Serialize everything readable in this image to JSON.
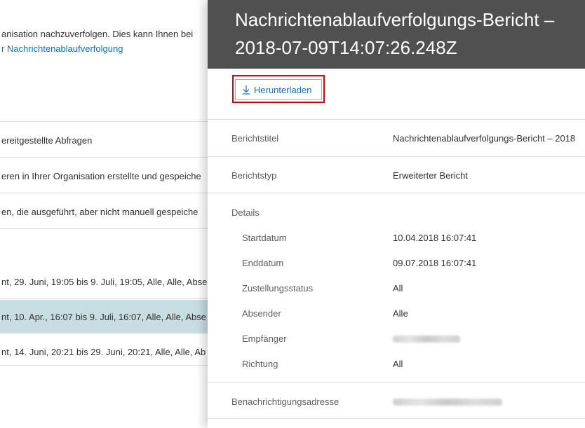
{
  "background_page": {
    "line1": "anisation nachzuverfolgen. Dies kann Ihnen bei",
    "line2_link": "r Nachrichtenablaufverfolgung",
    "rows": [
      "ereitgestellte Abfragen",
      "eren in Ihrer Organisation erstellte und gespeiche",
      "en, die ausgeführt, aber nicht manuell gespeiche"
    ],
    "results": [
      {
        "text": "nt, 29. Juni, 19:05 bis 9. Juli, 19:05, Alle, Alle, Abse",
        "selected": false
      },
      {
        "text": "nt, 10. Apr., 16:07 bis 9. Juli, 16:07, Alle, Alle, Abse",
        "selected": true
      },
      {
        "text": "nt, 14. Juni, 20:21 bis 29. Juni, 20:21, Alle, Alle, Ab",
        "selected": false
      }
    ]
  },
  "panel": {
    "title": "Nachrichtenablaufverfolgungs-Bericht –\n2018-07-09T14:07:26.248Z",
    "download_label": "Herunterladen",
    "download_icon": "download-arrow-icon",
    "fields": {
      "report_title_label": "Berichtstitel",
      "report_title_value": "Nachrichtenablaufverfolgungs-Bericht – 2018",
      "report_type_label": "Berichtstyp",
      "report_type_value": "Erweiterter Bericht",
      "details_label": "Details",
      "start_label": "Startdatum",
      "start_value": "10.04.2018 16:07:41",
      "end_label": "Enddatum",
      "end_value": "09.07.2018 16:07:41",
      "status_label": "Zustellungsstatus",
      "status_value": "All",
      "sender_label": "Absender",
      "sender_value": "Alle",
      "recipient_label": "Empfänger",
      "direction_label": "Richtung",
      "direction_value": "All",
      "notify_label": "Benachrichtigungsadresse"
    }
  },
  "colors": {
    "header_bg": "#505050",
    "link": "#106ebe",
    "highlight": "#e00000",
    "selected_row": "#c7dde2"
  }
}
